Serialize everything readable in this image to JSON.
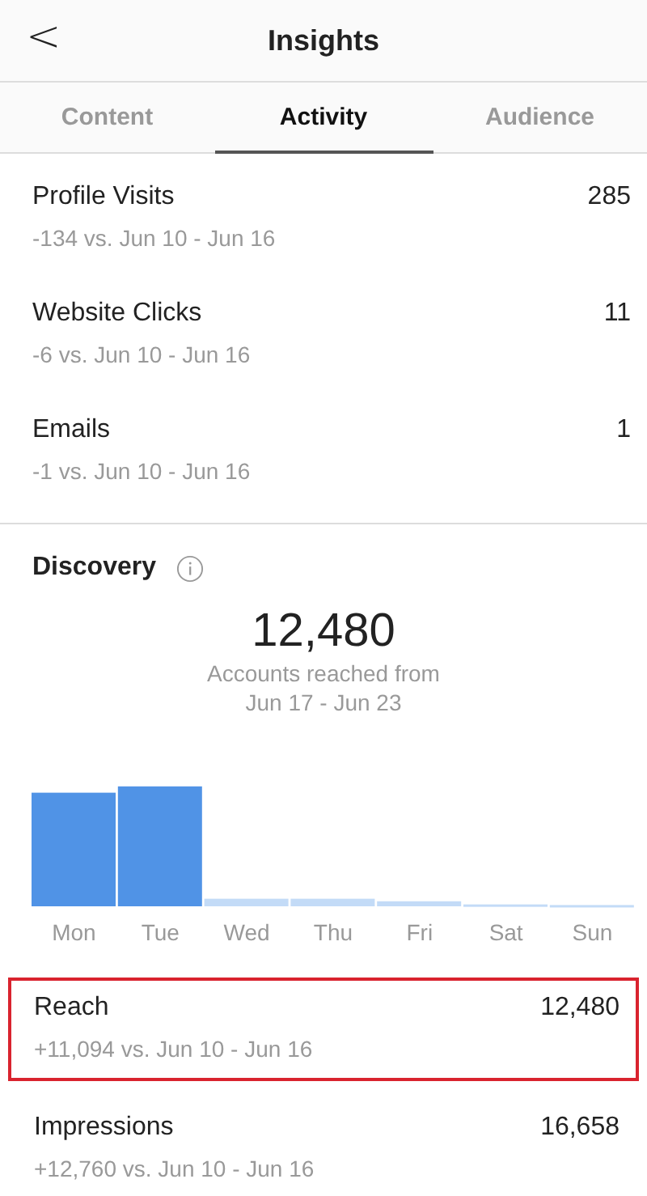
{
  "header": {
    "back": "<",
    "title": "Insights"
  },
  "tabs": [
    {
      "label": "Content",
      "selected": false
    },
    {
      "label": "Activity",
      "selected": true
    },
    {
      "label": "Audience",
      "selected": false
    }
  ],
  "interactions": [
    {
      "name": "Profile Visits",
      "value": "285",
      "comparison": "-134 vs. Jun 10 - Jun 16"
    },
    {
      "name": "Website Clicks",
      "value": "11",
      "comparison": "-6 vs. Jun 10 - Jun 16"
    },
    {
      "name": "Emails",
      "value": "1",
      "comparison": "-1 vs. Jun 10 - Jun 16"
    }
  ],
  "discovery": {
    "title": "Discovery",
    "total": "12,480",
    "caption": "Accounts reached from",
    "range": "Jun 17 - Jun 23",
    "days": [
      "Mon",
      "Tue",
      "Wed",
      "Thu",
      "Fri",
      "Sat",
      "Sun"
    ],
    "metrics": [
      {
        "name": "Reach",
        "value": "12,480",
        "comparison": "+11,094 vs. Jun 10 - Jun 16",
        "highlighted": true
      },
      {
        "name": "Impressions",
        "value": "16,658",
        "comparison": "+12,760 vs. Jun 10 - Jun 16",
        "highlighted": false
      }
    ]
  }
}
